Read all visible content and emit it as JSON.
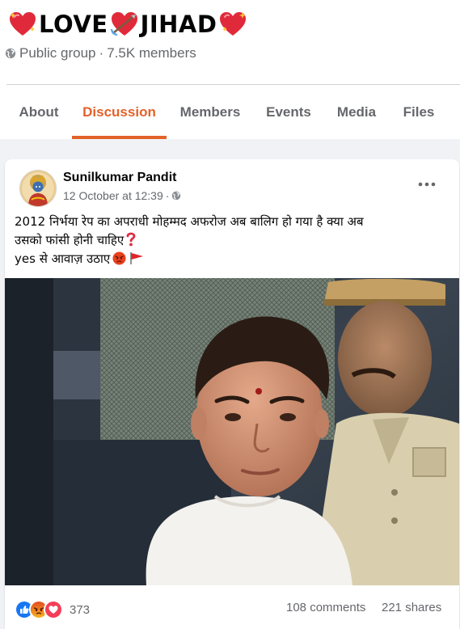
{
  "group": {
    "title_part1": "LOVE",
    "title_part2": "JIHAD",
    "privacy": "Public group",
    "separator": "·",
    "members": "7.5K members",
    "title_icons": [
      "sparkling-heart-icon",
      "heart-with-arrow-icon",
      "sparkling-heart-icon"
    ]
  },
  "tabs": [
    {
      "label": "About",
      "active": false
    },
    {
      "label": "Discussion",
      "active": true
    },
    {
      "label": "Members",
      "active": false
    },
    {
      "label": "Events",
      "active": false
    },
    {
      "label": "Media",
      "active": false
    },
    {
      "label": "Files",
      "active": false
    }
  ],
  "post": {
    "author": "Sunilkumar Pandit",
    "timestamp": "12 October at 12:39",
    "separator": "·",
    "privacy_icon": "globe-icon",
    "text_line1": "2012 निर्भया रेप का अपराधी मोहम्मद अफरोज अब बालिग हो गया है क्या अब",
    "text_line2": "उसको फांसी होनी चाहिए",
    "text_line3": "yes से आवाज़ उठाए",
    "text_icons": [
      "red-question-mark-icon",
      "angry-face-icon",
      "red-flag-icon"
    ],
    "image_icon": "news-photo",
    "reaction_icons": [
      "like-icon",
      "angry-icon",
      "love-icon"
    ],
    "reactions_count": "373",
    "comments": "108 comments",
    "shares": "221 shares"
  },
  "colors": {
    "accent": "#e4612a",
    "secondary_text": "#65676b",
    "background": "#f0f2f5",
    "like_blue": "#1877f2",
    "love_red": "#f33e58",
    "angry_orange": "#e9710f"
  }
}
